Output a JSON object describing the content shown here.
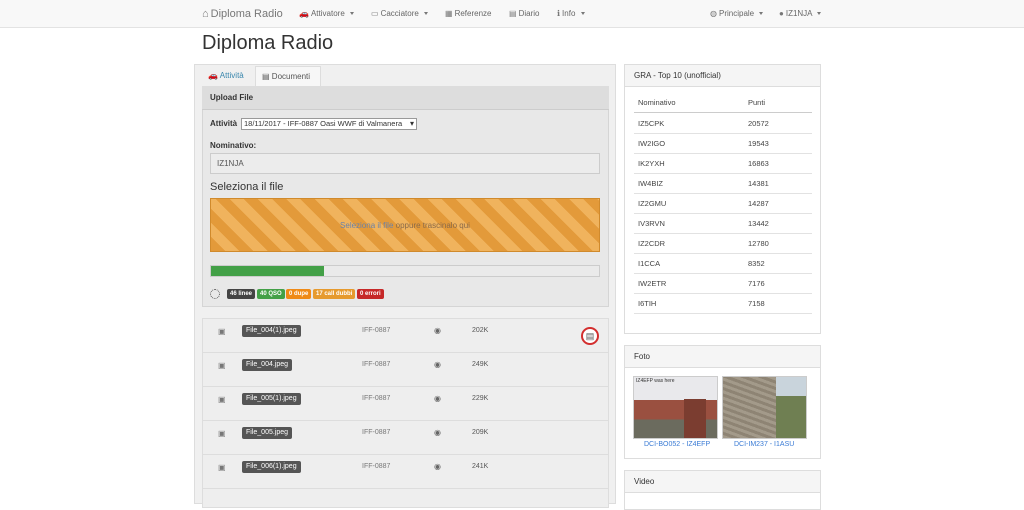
{
  "navbar": {
    "brand": "Diploma Radio",
    "items": [
      {
        "label": "Attivatore"
      },
      {
        "label": "Cacciatore"
      },
      {
        "label": "Referenze"
      },
      {
        "label": "Diario"
      },
      {
        "label": "Info"
      }
    ],
    "right": [
      {
        "label": "Principale"
      },
      {
        "label": "IZ1NJA"
      }
    ]
  },
  "page": {
    "title": "Diploma Radio"
  },
  "tabs": [
    {
      "label": "Attività"
    },
    {
      "label": "Documenti"
    }
  ],
  "upload": {
    "title": "Upload File",
    "activity_label": "Attività",
    "activity_value": "18/11/2017 - IFF-0887 Oasi WWF di Valmanera",
    "callsign_label": "Nominativo:",
    "callsign_value": "IZ1NJA",
    "select_label": "Seleziona il file",
    "drop_link": "Seleziona il file",
    "drop_text": "oppure trascinalo qui",
    "progress": 0.29,
    "badges": [
      {
        "label": "46 linee",
        "color": "#444444"
      },
      {
        "label": "40 QSO",
        "color": "#43a047"
      },
      {
        "label": "0 dupe",
        "color": "#ef8a17"
      },
      {
        "label": "17 call dubbi",
        "color": "#e69a2e"
      },
      {
        "label": "0 errori",
        "color": "#c62828"
      }
    ]
  },
  "files": [
    {
      "name": "File_004(1).jpeg",
      "ref": "IFF-0887",
      "size": "202K"
    },
    {
      "name": "File_004.jpeg",
      "ref": "IFF-0887",
      "size": "249K"
    },
    {
      "name": "File_005(1).jpeg",
      "ref": "IFF-0887",
      "size": "229K"
    },
    {
      "name": "File_005.jpeg",
      "ref": "IFF-0887",
      "size": "209K"
    },
    {
      "name": "File_006(1).jpeg",
      "ref": "IFF-0887",
      "size": "241K"
    }
  ],
  "top10": {
    "title": "GRA - Top 10 (unofficial)",
    "col_call": "Nominativo",
    "col_points": "Punti",
    "rows": [
      {
        "call": "IZ5CPK",
        "points": "20572"
      },
      {
        "call": "IW2IGO",
        "points": "19543"
      },
      {
        "call": "IK2YXH",
        "points": "16863"
      },
      {
        "call": "IW4BIZ",
        "points": "14381"
      },
      {
        "call": "IZ2GMU",
        "points": "14287"
      },
      {
        "call": "IV3RVN",
        "points": "13442"
      },
      {
        "call": "IZ2CDR",
        "points": "12780"
      },
      {
        "call": "I1CCA",
        "points": "8352"
      },
      {
        "call": "IW2ETR",
        "points": "7176"
      },
      {
        "call": "I6TIH",
        "points": "7158"
      }
    ]
  },
  "foto": {
    "title": "Foto",
    "photos": [
      {
        "caption": "DCI-BO052 - IZ4EFP",
        "overlay": "IZ4EFP was here"
      },
      {
        "caption": "DCI-IM237 - I1ASU"
      }
    ]
  },
  "video": {
    "title": "Video"
  }
}
